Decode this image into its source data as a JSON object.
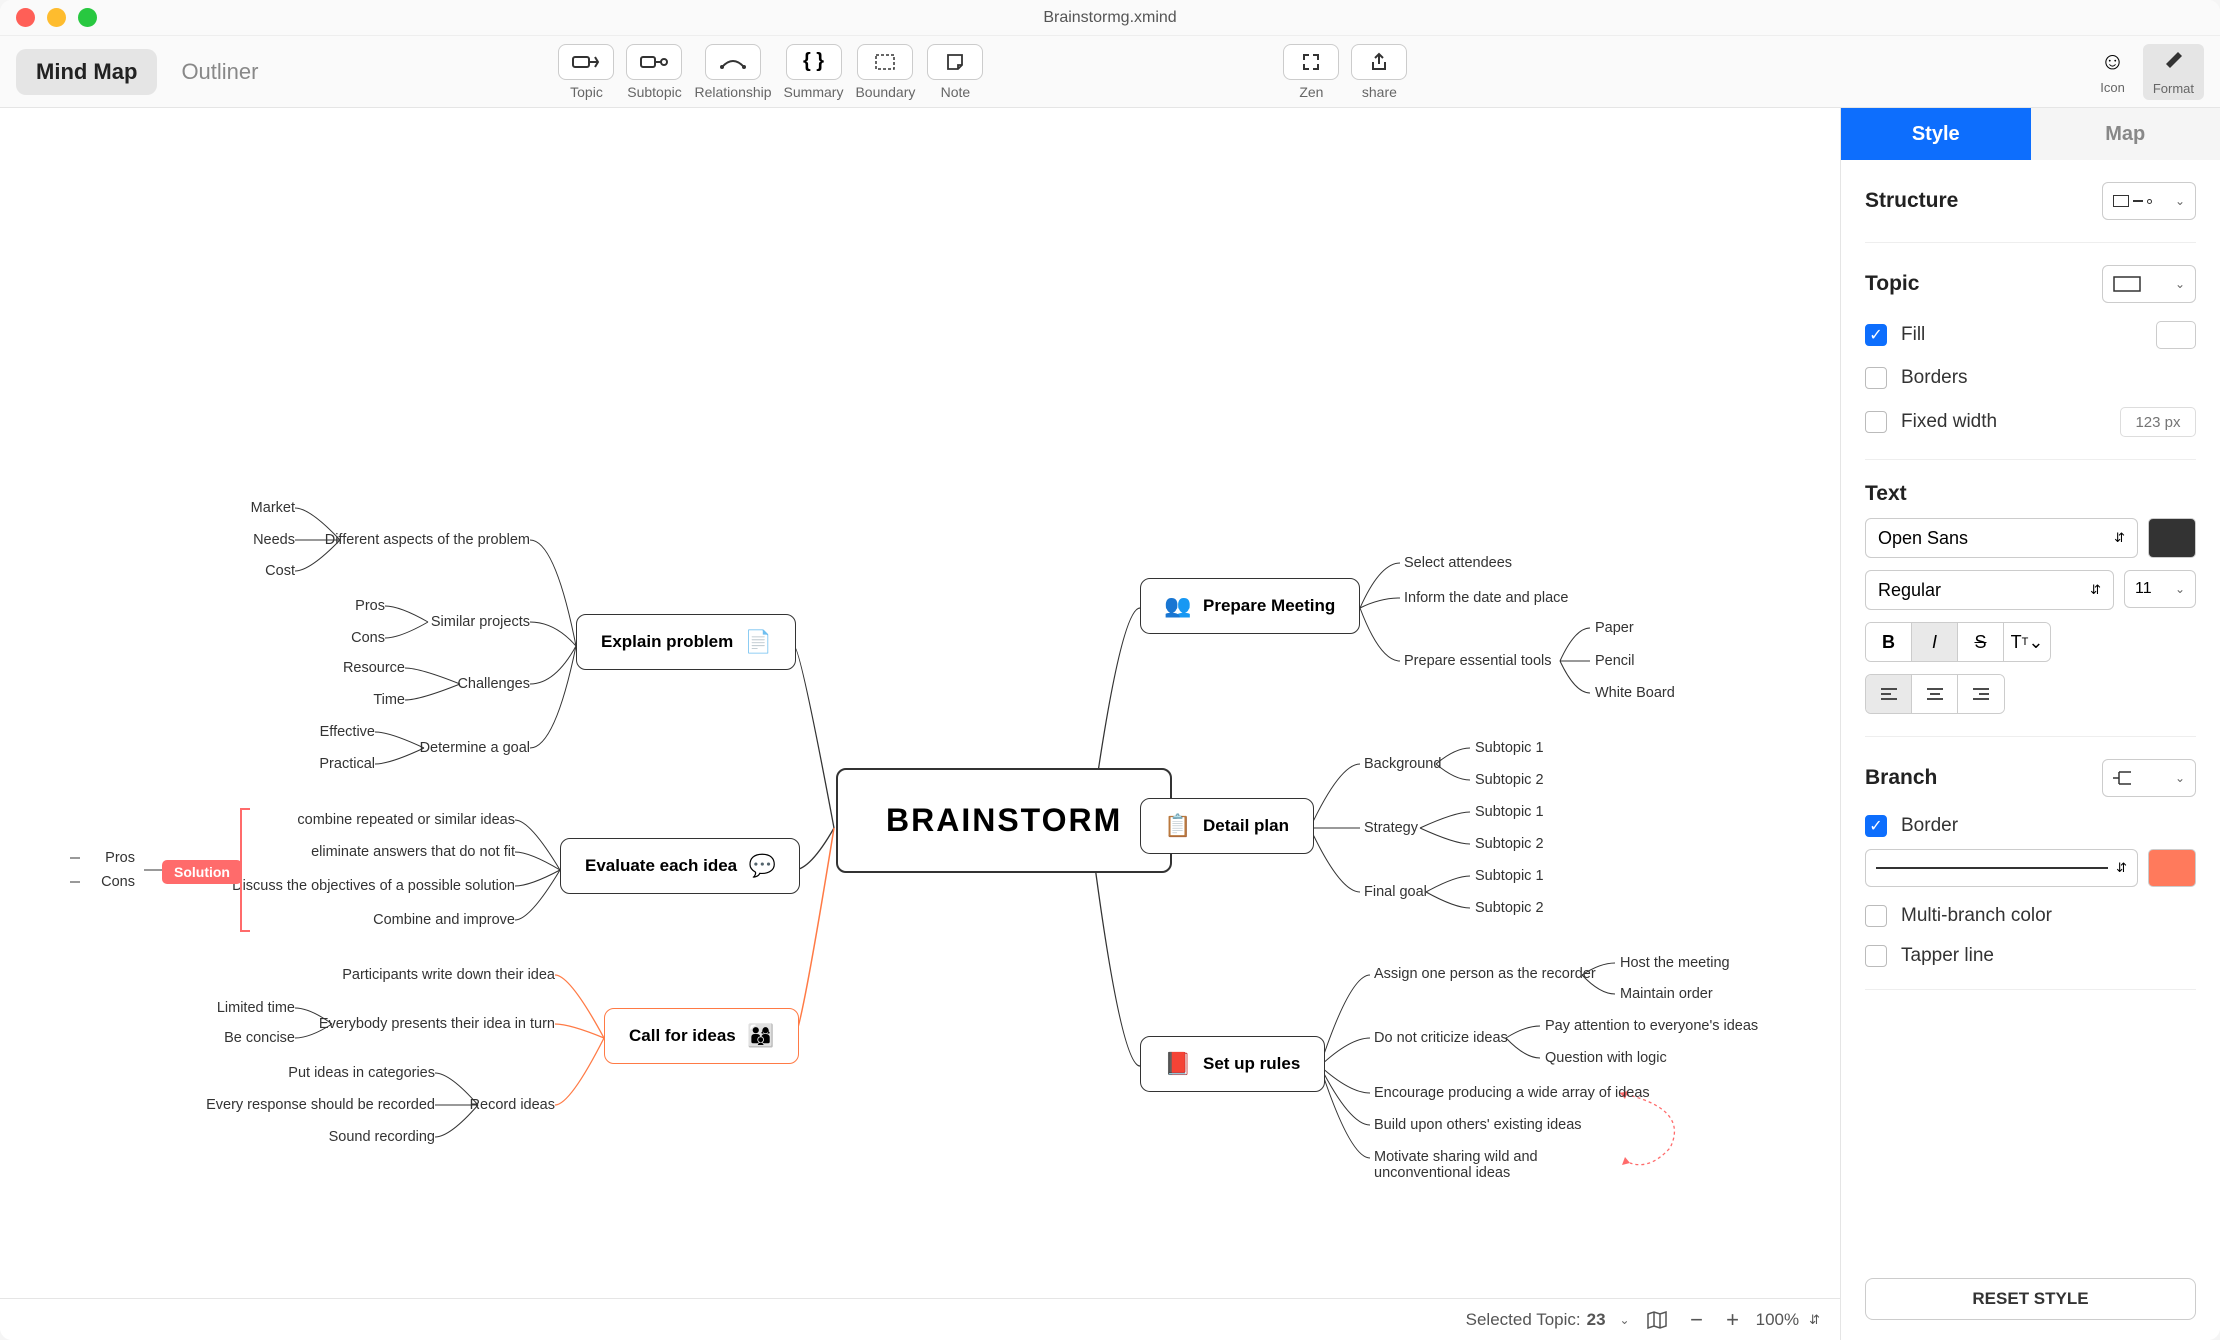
{
  "title": "Brainstormg.xmind",
  "views": {
    "mind_map": "Mind Map",
    "outliner": "Outliner"
  },
  "tools": {
    "topic": "Topic",
    "subtopic": "Subtopic",
    "relationship": "Relationship",
    "summary": "Summary",
    "boundary": "Boundary",
    "note": "Note",
    "zen": "Zen",
    "share": "share",
    "icon": "Icon",
    "format": "Format"
  },
  "panel": {
    "tabs": {
      "style": "Style",
      "map": "Map"
    },
    "structure": "Structure",
    "topic": "Topic",
    "fill": "Fill",
    "borders": "Borders",
    "fixed_width": "Fixed width",
    "fixed_width_placeholder": "123 px",
    "text": "Text",
    "font": "Open Sans",
    "weight": "Regular",
    "size": "11",
    "branch": "Branch",
    "border": "Border",
    "multi_branch": "Multi-branch color",
    "tapper": "Tapper line",
    "reset": "RESET STYLE"
  },
  "status": {
    "selected": "Selected Topic:",
    "count": "23",
    "zoom": "100%"
  },
  "mindmap": {
    "central": "BRAINSTORM",
    "right": {
      "prepare": {
        "t": "Prepare Meeting",
        "items": [
          "Select attendees",
          "Inform the date and place",
          "Prepare essential tools"
        ],
        "tools": [
          "Paper",
          "Pencil",
          "White Board"
        ]
      },
      "detail": {
        "t": "Detail plan",
        "groups": [
          "Background",
          "Strategy",
          "Final goal"
        ],
        "subs": [
          "Subtopic 1",
          "Subtopic 2"
        ]
      },
      "rules": {
        "t": "Set up rules",
        "items": [
          "Assign one person as the recorder",
          "Do not criticize ideas",
          "Encourage producing a wide array of ideas",
          "Build upon others' existing ideas",
          "Motivate sharing wild and unconventional ideas"
        ],
        "rec": [
          "Host the meeting",
          "Maintain order"
        ],
        "crit": [
          "Pay attention to everyone's ideas",
          "Question with logic"
        ]
      }
    },
    "left": {
      "explain": {
        "t": "Explain problem",
        "aspects": {
          "t": "Different aspects of the problem",
          "items": [
            "Market",
            "Needs",
            "Cost"
          ]
        },
        "similar": {
          "t": "Similar projects",
          "items": [
            "Pros",
            "Cons"
          ]
        },
        "challenges": {
          "t": "Challenges",
          "items": [
            "Resource",
            "Time"
          ]
        },
        "goal": {
          "t": "Determine a goal",
          "items": [
            "Effective",
            "Practical"
          ]
        }
      },
      "evaluate": {
        "t": "Evaluate each idea",
        "items": [
          "combine repeated or similar ideas",
          "eliminate answers that do not fit",
          "Discuss the objectives of a possible solution",
          "Combine and improve"
        ],
        "solution": {
          "tag": "Solution",
          "pros": "Pros",
          "cons": "Cons"
        }
      },
      "call": {
        "t": "Call for ideas",
        "items": [
          "Participants write down their idea",
          "Everybody presents their idea in turn",
          "Record ideas"
        ],
        "present": [
          "Limited time",
          "Be concise"
        ],
        "record": [
          "Put ideas in categories",
          "Every response should be recorded",
          "Sound recording"
        ]
      }
    }
  }
}
